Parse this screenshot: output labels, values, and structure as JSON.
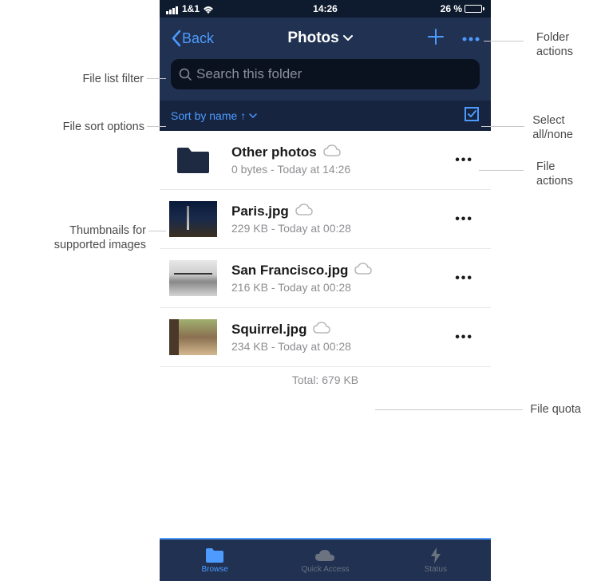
{
  "status": {
    "carrier": "1&1",
    "time": "14:26",
    "battery_pct": "26 %",
    "battery_fill_pct": 26
  },
  "nav": {
    "back_label": "Back",
    "title": "Photos"
  },
  "search": {
    "placeholder": "Search this folder"
  },
  "sort": {
    "label": "Sort by name",
    "direction": "↑"
  },
  "files": [
    {
      "name": "Other photos",
      "sub": "0 bytes - Today at 14:26",
      "type": "folder"
    },
    {
      "name": "Paris.jpg",
      "sub": "229 KB - Today at 00:28",
      "type": "image"
    },
    {
      "name": "San Francisco.jpg",
      "sub": "216 KB - Today at 00:28",
      "type": "image"
    },
    {
      "name": "Squirrel.jpg",
      "sub": "234 KB - Today at 00:28",
      "type": "image"
    }
  ],
  "total": "Total: 679 KB",
  "tabs": [
    {
      "label": "Browse",
      "active": true
    },
    {
      "label": "Quick Access",
      "active": false
    },
    {
      "label": "Status",
      "active": false
    }
  ],
  "callouts": {
    "folder_actions": "Folder\nactions",
    "file_filter": "File list filter",
    "sort_options": "File sort options",
    "select": "Select\nall/none",
    "file_actions": "File\nactions",
    "thumbnails": "Thumbnails for\nsupported images",
    "quota": "File quota"
  }
}
